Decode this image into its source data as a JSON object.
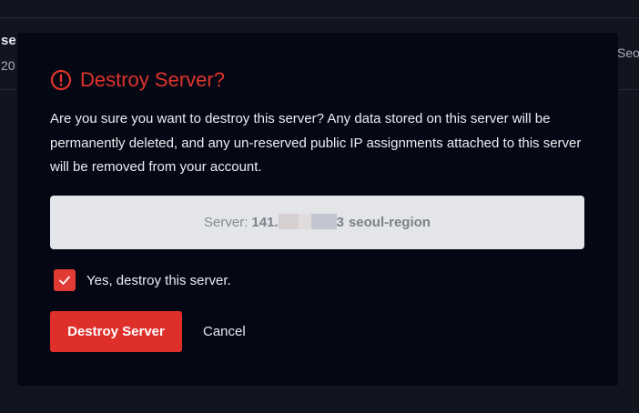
{
  "background": {
    "row_name": "se",
    "row_date": "20",
    "row_region": "Seo"
  },
  "dialog": {
    "title": "Destroy Server?",
    "title_icon": "alert-circle-icon",
    "message": "Are you sure you want to destroy this server? Any data stored on this server will be permanently deleted, and any un-reserved public IP assignments attached to this server will be removed from your account.",
    "server_prefix": "Server:",
    "server_ip_start": "141.",
    "server_ip_end": "3",
    "server_region": "seoul-region",
    "confirm_checked": true,
    "confirm_label": "Yes, destroy this server.",
    "destroy_button": "Destroy Server",
    "cancel_button": "Cancel"
  },
  "colors": {
    "danger": "#df2f2b",
    "modal_bg": "#050814",
    "page_bg": "#111520",
    "server_box_bg": "#e4e5e9"
  }
}
